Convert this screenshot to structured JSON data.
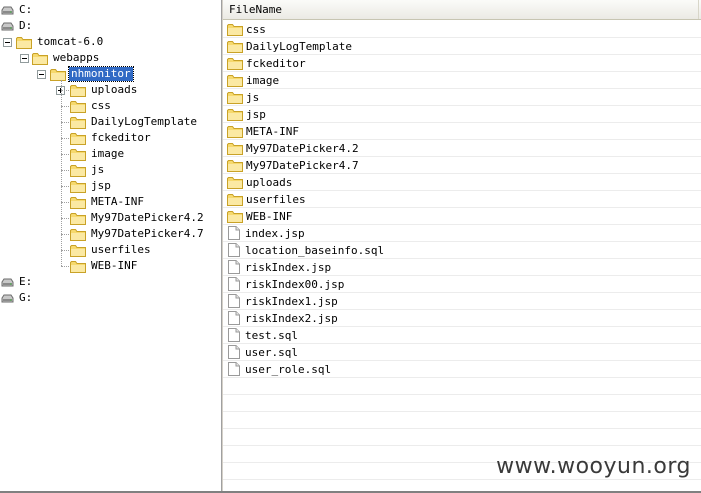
{
  "tree": {
    "drives_top": [
      {
        "label": "C:"
      },
      {
        "label": "D:"
      }
    ],
    "tomcat": {
      "label": "tomcat-6.0"
    },
    "webapps": {
      "label": "webapps"
    },
    "selected": {
      "label": "nhmonitor"
    },
    "children": [
      {
        "label": "uploads",
        "expandable": true
      },
      {
        "label": "css"
      },
      {
        "label": "DailyLogTemplate"
      },
      {
        "label": "fckeditor"
      },
      {
        "label": "image"
      },
      {
        "label": "js"
      },
      {
        "label": "jsp"
      },
      {
        "label": "META-INF"
      },
      {
        "label": "My97DatePicker4.2"
      },
      {
        "label": "My97DatePicker4.7"
      },
      {
        "label": "userfiles"
      },
      {
        "label": "WEB-INF"
      }
    ],
    "drives_bottom": [
      {
        "label": "E:"
      },
      {
        "label": "G:"
      }
    ]
  },
  "file_list": {
    "header": "FileName",
    "folders": [
      "css",
      "DailyLogTemplate",
      "fckeditor",
      "image",
      "js",
      "jsp",
      "META-INF",
      "My97DatePicker4.2",
      "My97DatePicker4.7",
      "uploads",
      "userfiles",
      "WEB-INF"
    ],
    "files": [
      "index.jsp",
      "location_baseinfo.sql",
      "riskIndex.jsp",
      "riskIndex00.jsp",
      "riskIndex1.jsp",
      "riskIndex2.jsp",
      "test.sql",
      "user.sql",
      "user_role.sql"
    ]
  },
  "watermark": "www.wooyun.org",
  "colors": {
    "selection": "#316ac5",
    "folder": "#f6d96e",
    "folder_edge": "#c9a227"
  }
}
